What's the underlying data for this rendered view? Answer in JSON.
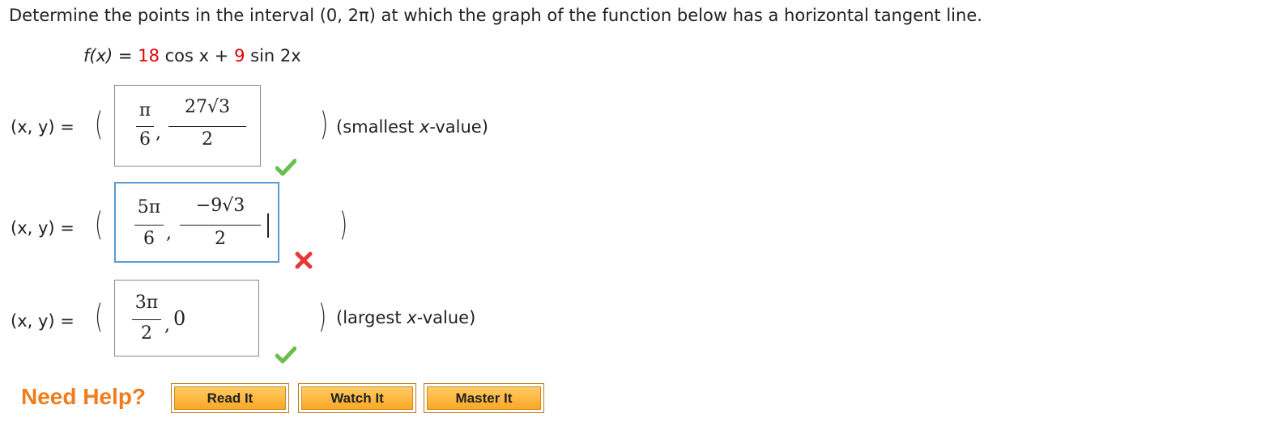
{
  "question": {
    "text": "Determine the points in the interval (0, 2π) at which the graph of the function below has a horizontal tangent line."
  },
  "function": {
    "lhs": "f(x)",
    "eq": "=",
    "coef1": "18",
    "term1": "cos x",
    "plus": "+",
    "coef2": "9",
    "term2": "sin 2x"
  },
  "answers": [
    {
      "label": "(x, y) =",
      "x_num": "π",
      "x_den": "6",
      "sep": ",",
      "y_num": "27√3",
      "y_den": "2",
      "hint": "(smallest x-value)",
      "status": "correct"
    },
    {
      "label": "(x, y) =",
      "x_num": "5π",
      "x_den": "6",
      "sep": ",",
      "y_num": "−9√3",
      "y_den": "2",
      "hint": "",
      "status": "incorrect"
    },
    {
      "label": "(x, y) =",
      "x_num": "3π",
      "x_den": "2",
      "sep": ",",
      "y_val": "0",
      "hint": "(largest x-value)",
      "status": "correct"
    }
  ],
  "help": {
    "title": "Need Help?",
    "buttons": [
      "Read It",
      "Watch It",
      "Master It"
    ]
  },
  "colors": {
    "correct": "#6abf4b",
    "incorrect": "#e53935",
    "help_title": "#f07c1b",
    "focus_border": "#5b9bd5"
  }
}
